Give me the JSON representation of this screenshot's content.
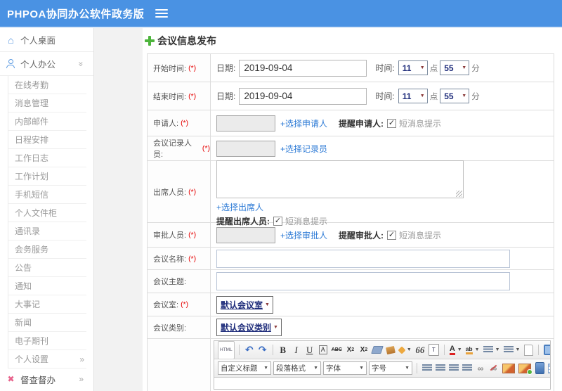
{
  "header": {
    "title": "PHPOA协同办公软件政务版"
  },
  "icons": {
    "home": "⌂",
    "supervise": "✖",
    "chevron": "»",
    "caret": "▼",
    "check": "✓",
    "undo": "↶",
    "redo": "↷",
    "chain": "∞"
  },
  "sidebar": {
    "desktop": "个人桌面",
    "office": "个人办公",
    "sub_items": [
      "在线考勤",
      "消息管理",
      "内部邮件",
      "日程安排",
      "工作日志",
      "工作计划",
      "手机短信",
      "个人文件柜",
      "通讯录",
      "会务服务",
      "公告",
      "通知",
      "大事记",
      "新闻",
      "电子期刊",
      "个人设置"
    ],
    "supervise": "督查督办"
  },
  "form": {
    "title": "会议信息发布",
    "required": "(*)",
    "date_label": "日期:",
    "time_label": "时间:",
    "hour_unit": "点",
    "minute_unit": "分",
    "start": {
      "label": "开始时间:",
      "date": "2019-09-04",
      "hour": "11",
      "minute": "55"
    },
    "end": {
      "label": "结束时间:",
      "date": "2019-09-04",
      "hour": "11",
      "minute": "55"
    },
    "applicant": {
      "label": "申请人:",
      "link": "+选择申请人",
      "remind": "提醒申请人:",
      "sms": "短消息提示"
    },
    "recorder": {
      "label": "会议记录人员:",
      "link": "+选择记录员"
    },
    "attendee": {
      "label": "出席人员:",
      "link": "+选择出席人",
      "remind": "提醒出席人员:",
      "sms": "短消息提示"
    },
    "approver": {
      "label": "审批人员:",
      "link": "+选择审批人",
      "remind": "提醒审批人:",
      "sms": "短消息提示"
    },
    "name": {
      "label": "会议名称:"
    },
    "topic": {
      "label": "会议主题:"
    },
    "room": {
      "label": "会议室:",
      "value": "默认会议室"
    },
    "category": {
      "label": "会议类别:",
      "value": "默认会议类别"
    }
  },
  "editor": {
    "t1": {
      "html": "HTML",
      "bold": "B",
      "italic": "I",
      "underline": "U",
      "fontbox": "A",
      "strike": "ABC",
      "sup_x": "X",
      "sup_n": "2",
      "sub_x": "X",
      "sub_n": "2",
      "quote": "66",
      "paste": "T",
      "fontcolor": "A",
      "highlight": "ab"
    },
    "t2": {
      "heading": "自定义标题",
      "paragraph": "段落格式",
      "font": "字体",
      "size": "字号"
    }
  }
}
